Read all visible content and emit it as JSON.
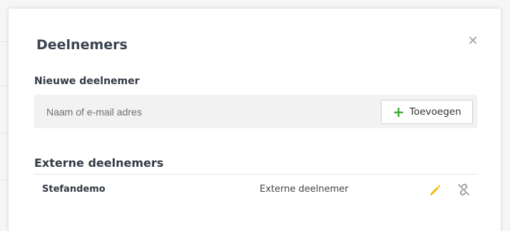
{
  "dialog": {
    "title": "Deelnemers",
    "close_icon": "close-icon"
  },
  "new_participant": {
    "label": "Nieuwe deelnemer",
    "input_value": "",
    "input_placeholder": "Naam of e-mail adres",
    "add_button_label": "Toevoegen",
    "add_icon": "plus-icon",
    "accent_color": "#3bab2f"
  },
  "external_participants": {
    "label": "Externe deelnemers",
    "rows": [
      {
        "name": "Stefandemo",
        "type": "Externe deelnemer",
        "edit_icon": "pencil-icon",
        "edit_icon_color": "#f5b800",
        "remove_icon": "unlink-icon"
      }
    ]
  }
}
